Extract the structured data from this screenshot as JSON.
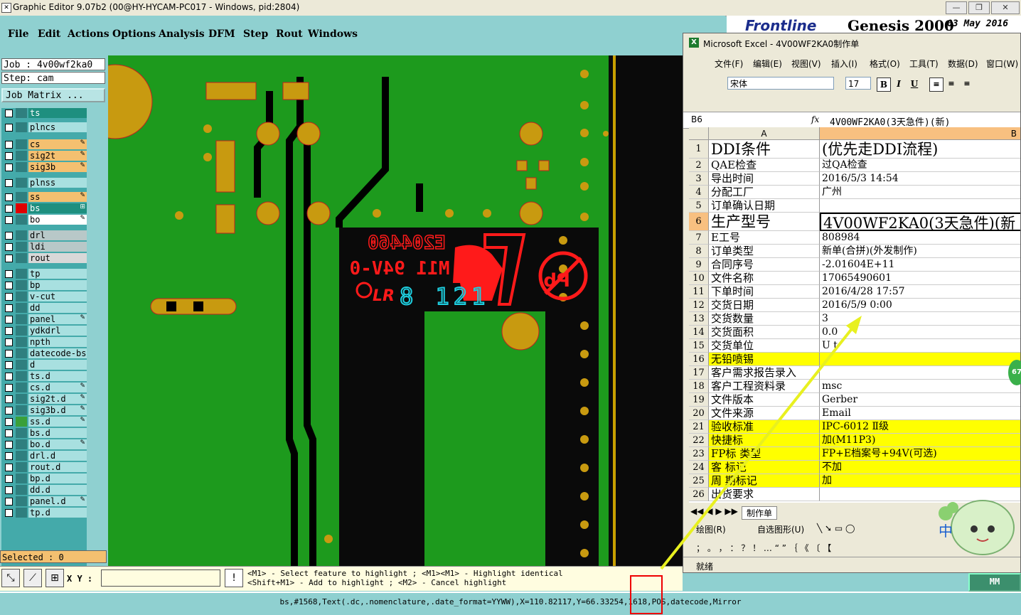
{
  "window": {
    "title": "Graphic Editor 9.07b2 (00@HY-HYCAM-PC017 - Windows, pid:2804)"
  },
  "menu": [
    "File",
    "Edit",
    "Actions",
    "Options",
    "Analysis",
    "DFM",
    "Step",
    "Rout",
    "Windows"
  ],
  "logo": {
    "brand": "Frontline",
    "product": "Genesis 2000",
    "date": "03 May 2016"
  },
  "job": {
    "job_line": "Job : 4v00wf2ka0",
    "step_line": "Step: cam",
    "matrix_button": "Job Matrix ..."
  },
  "layers": [
    {
      "name": "ts",
      "color": "#1e8f7f",
      "mark": ""
    },
    {
      "name": "plncs",
      "color": "#a8e0e0",
      "mark": ""
    },
    {
      "name": "cs",
      "color": "#f4c070",
      "mark": "✎"
    },
    {
      "name": "sig2t",
      "color": "#f4c070",
      "mark": "✎"
    },
    {
      "name": "sig3b",
      "color": "#f4c070",
      "mark": "✎"
    },
    {
      "name": "plnss",
      "color": "#a8e0e0",
      "mark": ""
    },
    {
      "name": "ss",
      "color": "#f4c070",
      "mark": "✎"
    },
    {
      "name": "bs",
      "color": "#1e8f7f",
      "mark": "⊞"
    },
    {
      "name": "bo",
      "color": "#ffffff",
      "mark": "✎"
    },
    {
      "name": "drl",
      "color": "#b8c8c8",
      "mark": ""
    },
    {
      "name": "ldi",
      "color": "#b8c8c8",
      "mark": ""
    },
    {
      "name": "rout",
      "color": "#d8d8d8",
      "mark": ""
    },
    {
      "name": "tp",
      "color": "#a8e0e0",
      "mark": ""
    },
    {
      "name": "bp",
      "color": "#a8e0e0",
      "mark": ""
    },
    {
      "name": "v-cut",
      "color": "#a8e0e0",
      "mark": ""
    },
    {
      "name": "dd",
      "color": "#a8e0e0",
      "mark": ""
    },
    {
      "name": "panel",
      "color": "#a8e0e0",
      "mark": "✎"
    },
    {
      "name": "ydkdrl",
      "color": "#a8e0e0",
      "mark": ""
    },
    {
      "name": "npth",
      "color": "#a8e0e0",
      "mark": ""
    },
    {
      "name": "datecode-bs",
      "color": "#a8e0e0",
      "mark": ""
    },
    {
      "name": "d",
      "color": "#a8e0e0",
      "mark": ""
    },
    {
      "name": "ts.d",
      "color": "#a8e0e0",
      "mark": ""
    },
    {
      "name": "cs.d",
      "color": "#a8e0e0",
      "mark": "✎"
    },
    {
      "name": "sig2t.d",
      "color": "#a8e0e0",
      "mark": "✎"
    },
    {
      "name": "sig3b.d",
      "color": "#a8e0e0",
      "mark": "✎"
    },
    {
      "name": "ss.d",
      "color": "#a8e0e0",
      "mark": "✎"
    },
    {
      "name": "bs.d",
      "color": "#a8e0e0",
      "mark": ""
    },
    {
      "name": "bo.d",
      "color": "#a8e0e0",
      "mark": "✎"
    },
    {
      "name": "drl.d",
      "color": "#a8e0e0",
      "mark": ""
    },
    {
      "name": "rout.d",
      "color": "#a8e0e0",
      "mark": ""
    },
    {
      "name": "bp.d",
      "color": "#a8e0e0",
      "mark": ""
    },
    {
      "name": "dd.d",
      "color": "#a8e0e0",
      "mark": ""
    },
    {
      "name": "panel.d",
      "color": "#a8e0e0",
      "mark": "✎"
    },
    {
      "name": "tp.d",
      "color": "#a8e0e0",
      "mark": ""
    }
  ],
  "selected": "Selected : 0",
  "board": {
    "text1": "E204460",
    "text2": "M11 94V-0",
    "datecode": "8 121"
  },
  "toolbar": {
    "xy_label": "X Y :",
    "help_line1": "<M1> - Select feature to highlight ; <M1><M1> - Highlight identical",
    "help_line2": "<Shift+M1> - Add to highlight ; <M2> - Cancel highlight"
  },
  "status": "bs,#1568,Text(.dc,.nomenclature,.date_format=YYWW),X=110.82117,Y=66.33254,1618,POS,datecode,Mirror",
  "excel": {
    "title": "Microsoft Excel - 4V00WF2KA0制作单",
    "menu": [
      "文件(F)",
      "编辑(E)",
      "视图(V)",
      "插入(I)",
      "格式(O)",
      "工具(T)",
      "数据(D)",
      "窗口(W)"
    ],
    "font": "宋体",
    "size": "17",
    "cell_ref": "B6",
    "formula": "4V00WF2KA0(3天急件)(新)",
    "col_a": "A",
    "col_b": "B",
    "rows": [
      {
        "n": "1",
        "a": "DDI条件",
        "b": "(优先走DDI流程)",
        "big": true,
        "yel": false
      },
      {
        "n": "2",
        "a": "QAE检查",
        "b": "过QA检查",
        "big": false,
        "yel": false
      },
      {
        "n": "3",
        "a": "导出时间",
        "b": "2016/5/3 14:54",
        "big": false,
        "yel": false
      },
      {
        "n": "4",
        "a": "分配工厂",
        "b": "广州",
        "big": false,
        "yel": false
      },
      {
        "n": "5",
        "a": "订单确认日期",
        "b": "",
        "big": false,
        "yel": false
      },
      {
        "n": "6",
        "a": "生产型号",
        "b": "4V00WF2KA0(3天急件)(新",
        "big": true,
        "yel": false
      },
      {
        "n": "7",
        "a": "E工号",
        "b": "808984",
        "big": false,
        "yel": false
      },
      {
        "n": "8",
        "a": "订单类型",
        "b": "新单(合拼)(外发制作)",
        "big": false,
        "yel": false
      },
      {
        "n": "9",
        "a": "合同序号",
        "b": "-2.01604E+11",
        "big": false,
        "yel": false
      },
      {
        "n": "10",
        "a": "文件名称",
        "b": "17065490601",
        "big": false,
        "yel": false
      },
      {
        "n": "11",
        "a": "下单时间",
        "b": "2016/4/28 17:57",
        "big": false,
        "yel": false
      },
      {
        "n": "12",
        "a": "交货日期",
        "b": "2016/5/9 0:00",
        "big": false,
        "yel": false
      },
      {
        "n": "13",
        "a": "交货数量",
        "b": "3",
        "big": false,
        "yel": false
      },
      {
        "n": "14",
        "a": "交货面积",
        "b": "0.0",
        "big": false,
        "yel": false
      },
      {
        "n": "15",
        "a": "交货单位",
        "b": "U t",
        "big": false,
        "yel": false
      },
      {
        "n": "16",
        "a": "无铅喷锡",
        "b": "",
        "big": false,
        "yel": true
      },
      {
        "n": "17",
        "a": "客户需求报告录入",
        "b": "",
        "big": false,
        "yel": false
      },
      {
        "n": "18",
        "a": "客户工程资料录",
        "b": "msc",
        "big": false,
        "yel": false
      },
      {
        "n": "19",
        "a": "文件版本",
        "b": "Gerber",
        "big": false,
        "yel": false
      },
      {
        "n": "20",
        "a": "文件来源",
        "b": "Email",
        "big": false,
        "yel": false
      },
      {
        "n": "21",
        "a": "验收标准",
        "b": "IPC-6012 Ⅱ级",
        "big": false,
        "yel": true
      },
      {
        "n": "22",
        "a": "快捷标",
        "b": "加(M11P3)",
        "big": false,
        "yel": true
      },
      {
        "n": "23",
        "a": "FP标 类型",
        "b": "FP+E档案号+94V(可选)",
        "big": false,
        "yel": true
      },
      {
        "n": "24",
        "a": "客 标记",
        "b": "不加",
        "big": false,
        "yel": true
      },
      {
        "n": "25",
        "a": "周 期标记",
        "b": "加",
        "big": false,
        "yel": true
      },
      {
        "n": "26",
        "a": "出货要求",
        "b": "",
        "big": false,
        "yel": false
      }
    ],
    "sheet_tab": "制作单",
    "draw_label": "绘图(R)",
    "autoshape_label": "自选图形(U)",
    "status": "就绪"
  },
  "mm_button": "MM",
  "badge": "67"
}
